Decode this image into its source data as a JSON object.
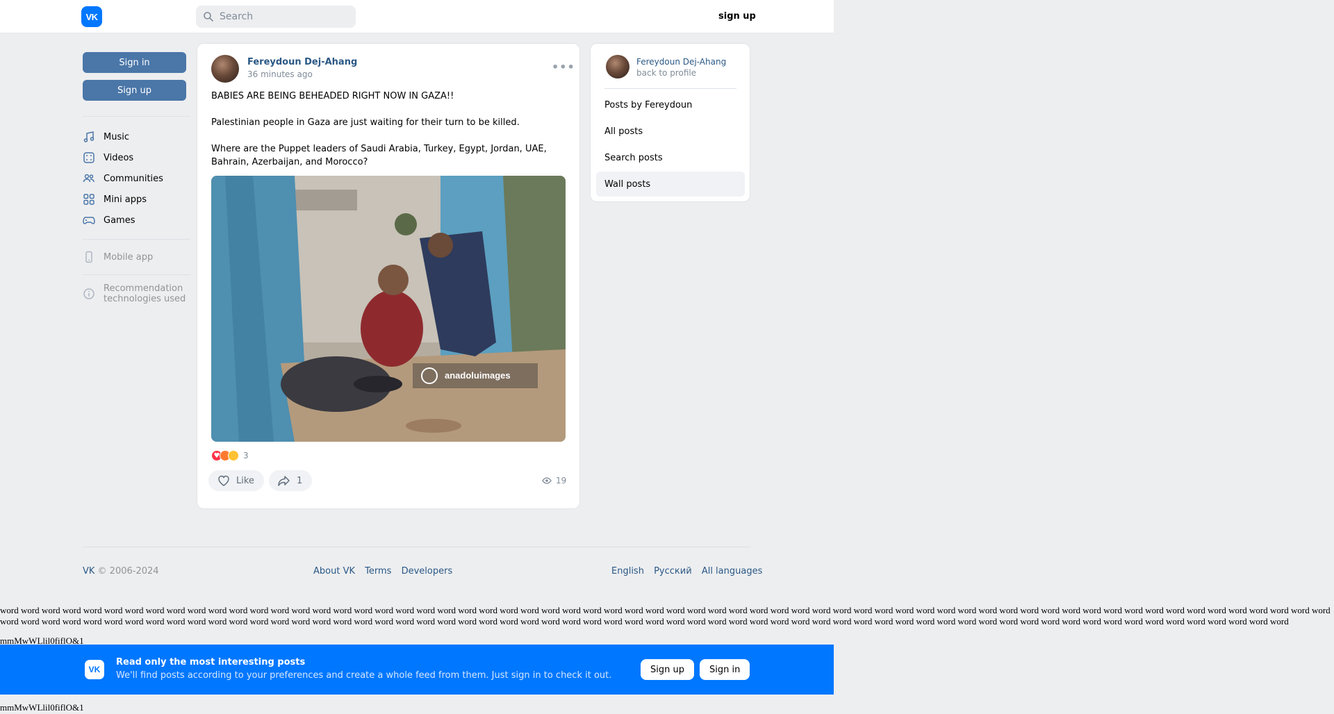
{
  "header": {
    "logo_text": "VK",
    "search_placeholder": "Search",
    "signup_label": "sign up"
  },
  "sidebar": {
    "signin_label": "Sign in",
    "signup_label": "Sign up",
    "items": [
      {
        "label": "Music",
        "icon": "music-icon"
      },
      {
        "label": "Videos",
        "icon": "video-icon"
      },
      {
        "label": "Communities",
        "icon": "users-icon"
      },
      {
        "label": "Mini apps",
        "icon": "apps-icon"
      },
      {
        "label": "Games",
        "icon": "gamepad-icon"
      }
    ],
    "mobile_app": "Mobile app",
    "recommendation_line1": "Recommendation",
    "recommendation_line2": "technologies used"
  },
  "post": {
    "author": "Fereydoun Dej-Ahang",
    "time": "36 minutes ago",
    "more": "•••",
    "paragraphs": [
      "BABIES ARE BEING BEHEADED RIGHT NOW IN GAZA!!",
      "Palestinian people in Gaza are just waiting for their turn to be killed.",
      "Where are the Puppet leaders of Saudi Arabia, Turkey, Egypt, Jordan, UAE, Bahrain, Azerbaijan, and Morocco?"
    ],
    "photo_watermark": "anadoluimages",
    "reactions_count": "3",
    "like_label": "Like",
    "share_count": "1",
    "views": "19"
  },
  "profile_card": {
    "name": "Fereydoun Dej-Ahang",
    "sub": "back to profile",
    "items": [
      "Posts by Fereydoun",
      "All posts",
      "Search posts",
      "Wall posts"
    ],
    "active_item": "Wall posts"
  },
  "footer": {
    "copyright_vk": "VK",
    "copyright_years": " © 2006-2024",
    "about": "About VK",
    "terms": "Terms",
    "developers": "Developers",
    "english": "English",
    "russian": "Русский",
    "all_languages": "All languages"
  },
  "filler_text": "word word word word word word word word word word word word word word word word word word word word word word word word word word word word word word word word word word word word word word word word word word word word word word word word word word word word word word word word word word word word word word word word word word word word word word word word word word word word word word word word word word word word word word word word word word word word word word word word word word word word word word word word word word word word word word word word word word word word word word word word word word word word word word",
  "glyph_string": "mmMwWLlil0fiflO&1",
  "banner": {
    "logo_text": "VK",
    "title": "Read only the most interesting posts",
    "subtitle": "We'll find posts according to your preferences and create a whole feed from them. Just sign in to check it out.",
    "signup_label": "Sign up",
    "signin_label": "Sign in"
  },
  "colors": {
    "vk_blue": "#0077ff",
    "button_blue": "#4a76a8",
    "link": "#2a5885",
    "background": "#edeef0"
  }
}
